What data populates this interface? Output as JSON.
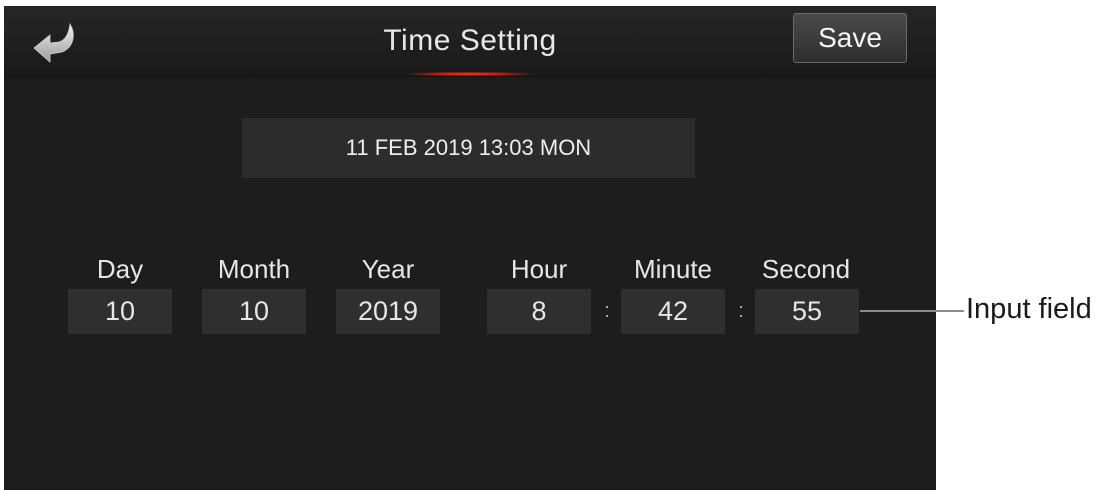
{
  "header": {
    "title": "Time Setting",
    "save_label": "Save",
    "back_icon": "back-arrow-icon",
    "accent_color": "#d8261a"
  },
  "current_datetime": "11 FEB 2019 13:03 MON",
  "fields": {
    "day": {
      "label": "Day",
      "value": "10"
    },
    "month": {
      "label": "Month",
      "value": "10"
    },
    "year": {
      "label": "Year",
      "value": "2019"
    },
    "hour": {
      "label": "Hour",
      "value": "8"
    },
    "minute": {
      "label": "Minute",
      "value": "42"
    },
    "second": {
      "label": "Second",
      "value": "55"
    }
  },
  "separators": [
    ":",
    ":"
  ],
  "annotation": {
    "text": "Input field"
  }
}
